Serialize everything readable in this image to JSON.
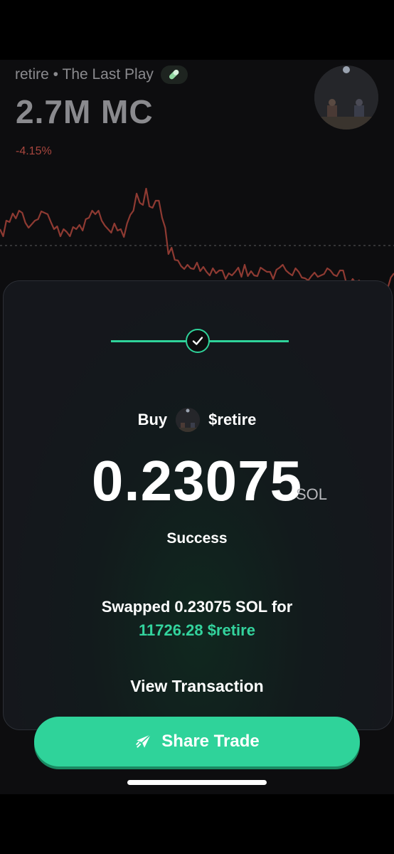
{
  "token": {
    "name_line": "retire • The Last Play",
    "badge_icon": "pill-icon",
    "market_cap": "2.7M MC",
    "change": "-4.15%"
  },
  "chart_data": {
    "type": "line",
    "title": "",
    "values": [
      322,
      332,
      310,
      312,
      300,
      307,
      296,
      299,
      313,
      320,
      315,
      310,
      308,
      297,
      299,
      301,
      312,
      322,
      318,
      332,
      322,
      326,
      332,
      319,
      322,
      316,
      324,
      308,
      306,
      296,
      301,
      296,
      310,
      317,
      322,
      327,
      314,
      324,
      322,
      333,
      314,
      302,
      296,
      272,
      285,
      288,
      265,
      290,
      292,
      282,
      282,
      306,
      320,
      357,
      348,
      365,
      366,
      374,
      378,
      372,
      377,
      378,
      369,
      381,
      375,
      382,
      387,
      377,
      384,
      380,
      380,
      392,
      384,
      387,
      382,
      376,
      389,
      372,
      388,
      381,
      387,
      388,
      376,
      379,
      382,
      382,
      392,
      379,
      376,
      372,
      380,
      384,
      387,
      377,
      382,
      390,
      391,
      394,
      388,
      383,
      389,
      387,
      385,
      377,
      380,
      386,
      388,
      380,
      380,
      398,
      400,
      392,
      398,
      394,
      403,
      413,
      417,
      425,
      410,
      425,
      440,
      435,
      405,
      390,
      384
    ],
    "baseline": 345,
    "color": "#8e3a32",
    "baseline_color": "#5a5a5e"
  },
  "trade": {
    "buy_label": "Buy",
    "ticker": "$retire",
    "amount": "0.23075",
    "unit": "SOL",
    "status": "Success",
    "swap_text": "Swapped 0.23075 SOL for",
    "swap_received": "11726.28 $retire",
    "view_tx_label": "View Transaction",
    "share_label": "Share Trade",
    "share_icon": "send-icon",
    "accent": "#2fd39a"
  }
}
